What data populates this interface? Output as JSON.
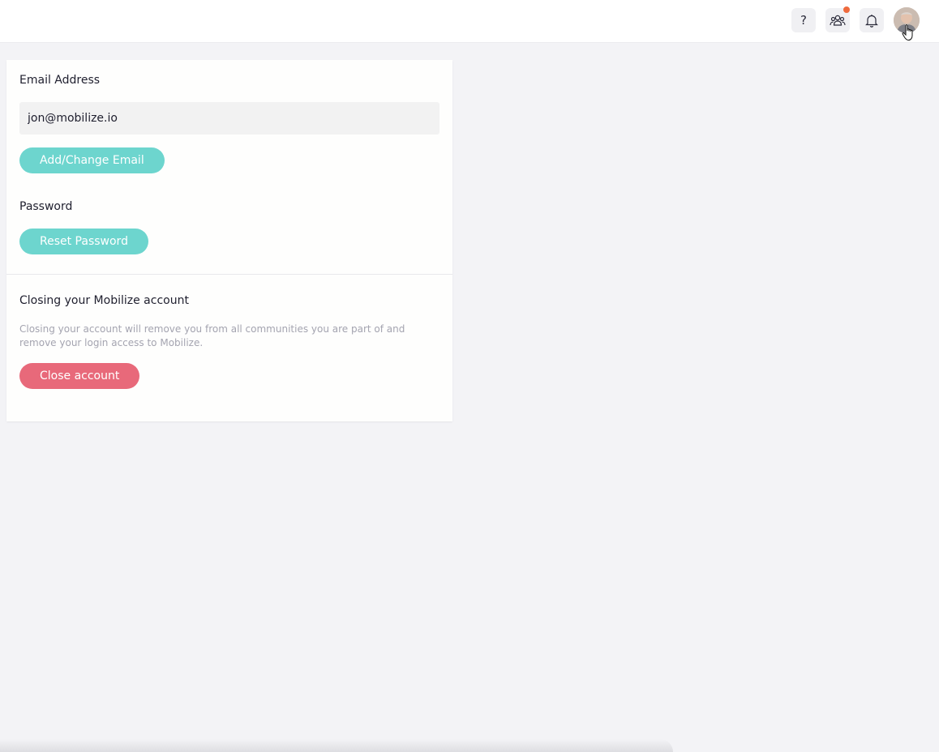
{
  "header": {
    "help_icon": "question-mark-icon",
    "community_icon": "people-group-icon",
    "notifications_icon": "bell-icon",
    "avatar": "user-avatar",
    "notification_dot_color": "#ee6a3d"
  },
  "settings": {
    "email": {
      "label": "Email Address",
      "value": "jon@mobilize.io",
      "button_label": "Add/Change Email"
    },
    "password": {
      "label": "Password",
      "button_label": "Reset Password"
    },
    "close_account": {
      "title": "Closing your Mobilize account",
      "description": "Closing your account will remove you from all communities you are part of and remove your login access to Mobilize.",
      "button_label": "Close account"
    }
  },
  "colors": {
    "accent_teal": "#6dd5ce",
    "danger_red": "#e8697a",
    "background": "#f3f3f6"
  }
}
